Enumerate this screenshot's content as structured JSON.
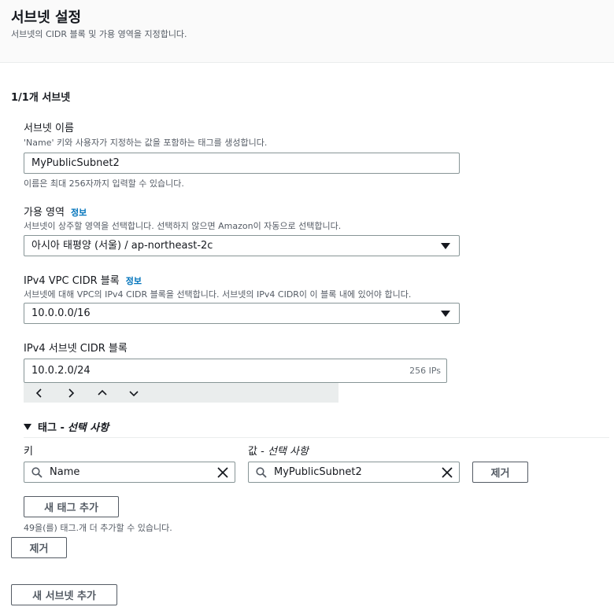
{
  "header": {
    "title": "서브넷 설정",
    "description": "서브넷의 CIDR 블록 및 가용 영역을 지정합니다."
  },
  "section": {
    "title": "1/1개 서브넷"
  },
  "subnet_name": {
    "label": "서브넷 이름",
    "description": "'Name' 키와 사용자가 지정하는 값을 포함하는 태그를 생성합니다.",
    "value": "MyPublicSubnet2",
    "hint": "이름은 최대 256자까지 입력할 수 있습니다."
  },
  "availability_zone": {
    "label": "가용 영역",
    "info_link": "정보",
    "description": "서브넷이 상주할 영역을 선택합니다. 선택하지 않으면 Amazon이 자동으로 선택합니다.",
    "selected": "아시아 태평양 (서울) / ap-northeast-2c"
  },
  "vpc_cidr": {
    "label": "IPv4 VPC CIDR 블록",
    "info_link": "정보",
    "description": "서브넷에 대해 VPC의 IPv4 CIDR 블록을 선택합니다. 서브넷의 IPv4 CIDR이 이 블록 내에 있어야 합니다.",
    "selected": "10.0.0.0/16"
  },
  "subnet_cidr": {
    "label": "IPv4 서브넷 CIDR 블록",
    "value": "10.0.2.0/24",
    "ip_count": "256 IPs"
  },
  "tags": {
    "toggle_label": "태그 -",
    "toggle_optional": "선택 사항",
    "key_label": "키",
    "value_label_prefix": "값 -",
    "value_label_optional": "선택 사항",
    "key_value": "Name",
    "value_value": "MyPublicSubnet2",
    "remove_label": "제거",
    "add_tag_label": "새 태그 추가",
    "remaining_hint": "49을(를) 태그.개 더 추가할 수 있습니다."
  },
  "actions": {
    "remove_subnet_label": "제거",
    "add_subnet_label": "새 서브넷 추가"
  },
  "icons": {
    "stepper": [
      "chevron-left-icon",
      "chevron-right-icon",
      "chevron-up-icon",
      "chevron-down-icon"
    ],
    "search": "search-icon",
    "clear": "close-icon"
  },
  "colors": {
    "link": "#0073bb",
    "border": "#879596",
    "text": "#16191f",
    "muted": "#545b64"
  }
}
